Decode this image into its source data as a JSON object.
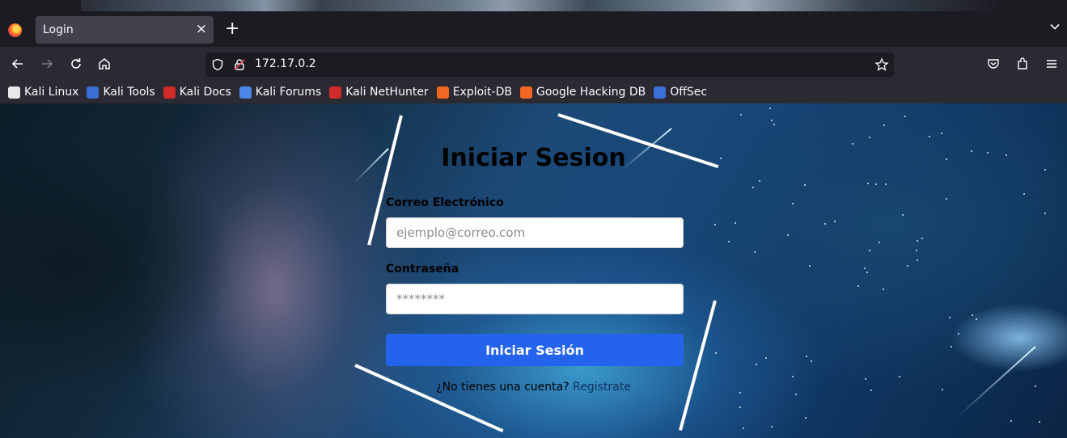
{
  "browser": {
    "tab": {
      "title": "Login",
      "close_glyph": "×"
    },
    "new_tab_glyph": "+",
    "url": "172.17.0.2",
    "bookmarks": [
      {
        "label": "Kali Linux",
        "icon": "kali-dragon-icon",
        "color": "#e8e8e8"
      },
      {
        "label": "Kali Tools",
        "icon": "kali-tools-icon",
        "color": "#3b6fd6"
      },
      {
        "label": "Kali Docs",
        "icon": "kali-docs-icon",
        "color": "#d12a2a"
      },
      {
        "label": "Kali Forums",
        "icon": "kali-forums-icon",
        "color": "#4a86e8"
      },
      {
        "label": "Kali NetHunter",
        "icon": "kali-nethunter-icon",
        "color": "#d12a2a"
      },
      {
        "label": "Exploit-DB",
        "icon": "exploit-db-icon",
        "color": "#f26722"
      },
      {
        "label": "Google Hacking DB",
        "icon": "ghdb-icon",
        "color": "#f26722"
      },
      {
        "label": "OffSec",
        "icon": "offsec-icon",
        "color": "#3d6fd9"
      }
    ]
  },
  "login": {
    "title": "Iniciar Sesion",
    "email_label": "Correo Electrónico",
    "email_placeholder": "ejemplo@correo.com",
    "password_label": "Contraseña",
    "password_placeholder": "********",
    "submit_label": "Iniciar Sesión",
    "signup_prompt": "¿No tienes una cuenta?",
    "signup_link": "Registrate"
  },
  "colors": {
    "button": "#2463eb",
    "link": "#15315e",
    "browser_toolbar": "#2b2a33",
    "browser_tabstrip": "#1c1b22"
  }
}
